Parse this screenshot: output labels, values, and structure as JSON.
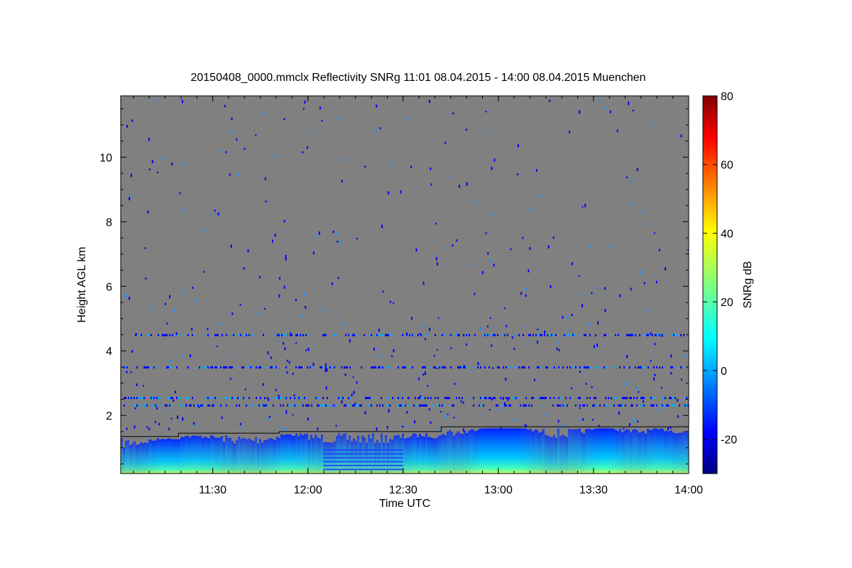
{
  "chart_data": {
    "type": "heatmap",
    "title": "20150408_0000.mmclx Reflectivity SNRg   11:01 08.04.2015 - 14:00 08.04.2015 Muenchen",
    "xlabel": "Time UTC",
    "ylabel": "Height AGL km",
    "x_ticks": [
      "11:30",
      "12:00",
      "12:30",
      "13:00",
      "13:30",
      "14:00"
    ],
    "x_tick_hours": [
      11.5,
      12.0,
      12.5,
      13.0,
      13.5,
      14.0
    ],
    "xlim_hours": [
      11.0167,
      14.0
    ],
    "y_ticks": [
      "2",
      "4",
      "6",
      "8",
      "10"
    ],
    "y_tick_values": [
      2,
      4,
      6,
      8,
      10
    ],
    "ylim": [
      0.2,
      11.9
    ],
    "colorbar": {
      "label": "SNRg dB",
      "ticks": [
        "-20",
        "0",
        "20",
        "40",
        "60",
        "80"
      ],
      "tick_values": [
        -20,
        0,
        20,
        40,
        60,
        80
      ],
      "range": [
        -30,
        80
      ]
    },
    "background_color": "#808080",
    "noise_layers_km": [
      4.5,
      3.5,
      2.55,
      2.32
    ],
    "boundary_layer_top_km": [
      {
        "t": 11.0167,
        "h": 1.35
      },
      {
        "t": 11.32,
        "h": 1.45
      },
      {
        "t": 11.85,
        "h": 1.5
      },
      {
        "t": 12.7,
        "h": 1.65
      },
      {
        "t": 14.0,
        "h": 1.65
      }
    ]
  }
}
